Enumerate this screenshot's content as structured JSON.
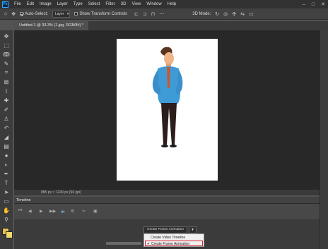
{
  "app": {
    "logo": "Ps"
  },
  "menu": [
    "File",
    "Edit",
    "Image",
    "Layer",
    "Type",
    "Select",
    "Filter",
    "3D",
    "View",
    "Window",
    "Help"
  ],
  "window_controls": [
    "–",
    "□",
    "✕"
  ],
  "options": {
    "auto_select_label": "Auto-Select:",
    "auto_select_checked": true,
    "auto_select_target": "Layer",
    "transform_controls_label": "Show Transform Controls",
    "transform_controls_checked": false,
    "mode_label": "3D Mode:"
  },
  "document": {
    "tab_title": "Untitled-1 @ 33.3% (1.jpg, RGB/8#) *",
    "status": "885 px × 1249 px (96 ppi)"
  },
  "timeline": {
    "title": "Timeline",
    "create_button": "Create Frame Animation",
    "dropdown_arrow": "▾",
    "options": [
      {
        "label": "Create Video Timeline",
        "checked": false
      },
      {
        "label": "Create Frame Animation",
        "checked": true
      }
    ],
    "check_mark": "✔"
  },
  "colors": {
    "foreground": "#e7c055",
    "background": "#f2d96e",
    "highlight": "#d0202f"
  }
}
